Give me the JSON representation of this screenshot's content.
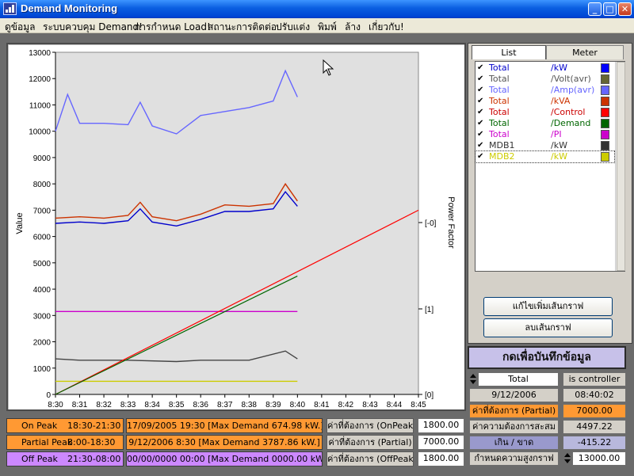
{
  "window": {
    "title": "Demand Monitoring"
  },
  "menu": [
    "ดูข้อมูล",
    "ระบบควบคุม Demand!",
    "การกำหนด Load!",
    "สถานะการติดต่อ",
    "ปรับแต่ง",
    "พิมพ์",
    "ล้าง",
    "เกี่ยวกับ!"
  ],
  "tabs": {
    "list": "List",
    "meter": "Meter"
  },
  "channels": [
    {
      "name": "Total",
      "unit": "/kW",
      "color": "#0000ff",
      "text_color": "#0000cc",
      "checked": true
    },
    {
      "name": "Total",
      "unit": "/Volt(avr)",
      "color": "#666633",
      "text_color": "#555555",
      "checked": true
    },
    {
      "name": "Total",
      "unit": "/Amp(avr)",
      "color": "#6666ff",
      "text_color": "#6666ff",
      "checked": true
    },
    {
      "name": "Total",
      "unit": "/kVA",
      "color": "#cc3300",
      "text_color": "#cc3300",
      "checked": true
    },
    {
      "name": "Total",
      "unit": "/Control",
      "color": "#ff0000",
      "text_color": "#cc0000",
      "checked": true
    },
    {
      "name": "Total",
      "unit": "/Demand",
      "color": "#006600",
      "text_color": "#006600",
      "checked": true
    },
    {
      "name": "Total",
      "unit": "/PI",
      "color": "#cc00cc",
      "text_color": "#cc00cc",
      "checked": true
    },
    {
      "name": "MDB1",
      "unit": "/kW",
      "color": "#333333",
      "text_color": "#333333",
      "checked": true
    },
    {
      "name": "MDB2",
      "unit": "/kW",
      "color": "#cccc00",
      "text_color": "#cccc00",
      "checked": true
    }
  ],
  "buttons": {
    "edit_line": "แก้ไขเพิ่มเส้นกราฟ",
    "delete_line": "ลบเส้นกราฟ",
    "save": "กดเพื่อบันทึกข้อมูล"
  },
  "readouts": {
    "selector": "Total",
    "status": "is controller",
    "date": "9/12/2006",
    "time": "08:40:02",
    "partial_label": "ค่าที่ต้องการ (Partial)",
    "partial_value": "7000.00",
    "accum_label": "ค่าความต้องการสะสม",
    "accum_value": "4497.22",
    "over_label": "เกิน / ขาด",
    "over_value": "-415.22",
    "graph_max_label": "กำหนดความสูงกราฟ",
    "graph_max_value": "13000.00"
  },
  "peaks": [
    {
      "name": "On Peak",
      "hours": "18:30-21:30",
      "max": "17/09/2005  19:30 [Max Demand   674.98 kW.]",
      "need_label": "ค่าที่ต้องการ (OnPeak)",
      "need_value": "1800.00"
    },
    {
      "name": "Partial Peak",
      "hours": "8:00-18:30",
      "max": "9/12/2006   8:30 [Max Demand  3787.86 kW.]",
      "need_label": "ค่าที่ต้องการ (Partial)",
      "need_value": "7000.00"
    },
    {
      "name": "Off Peak",
      "hours": "21:30-08:00",
      "max": "00/00/0000  00:00 [Max Demand 0000.00 kW.]",
      "need_label": "ค่าที่ต้องการ (OffPeak)",
      "need_value": "1800.00"
    }
  ],
  "chart_data": {
    "type": "line",
    "ylabel": "Value",
    "y2label": "Power Factor",
    "ylim": [
      0,
      13000
    ],
    "yticks": [
      0,
      1000,
      2000,
      3000,
      4000,
      5000,
      6000,
      7000,
      8000,
      9000,
      10000,
      11000,
      12000,
      13000
    ],
    "y2ticks": [
      "[0]",
      "[1]",
      "[-0]"
    ],
    "xticks": [
      "8:30",
      "8:31",
      "8:32",
      "8:33",
      "8:34",
      "8:35",
      "8:36",
      "8:37",
      "8:38",
      "8:39",
      "8:40",
      "8:41",
      "8:42",
      "8:43",
      "8:44",
      "8:45"
    ],
    "grid": false,
    "series": [
      {
        "color": "#0000cc",
        "x": [
          "8:30",
          "8:31",
          "8:32",
          "8:33",
          "8:33:30",
          "8:34",
          "8:35",
          "8:36",
          "8:37",
          "8:38",
          "8:39",
          "8:39:30",
          "8:40"
        ],
        "values": [
          6500,
          6550,
          6500,
          6600,
          7050,
          6550,
          6400,
          6650,
          6950,
          6950,
          7050,
          7700,
          7150
        ]
      },
      {
        "color": "#cc3300",
        "x": [
          "8:30",
          "8:31",
          "8:32",
          "8:33",
          "8:33:30",
          "8:34",
          "8:35",
          "8:36",
          "8:37",
          "8:38",
          "8:39",
          "8:39:30",
          "8:40"
        ],
        "values": [
          6700,
          6750,
          6700,
          6800,
          7300,
          6750,
          6600,
          6850,
          7200,
          7150,
          7250,
          8000,
          7350
        ]
      },
      {
        "color": "#6666ff",
        "x": [
          "8:30",
          "8:30:30",
          "8:31",
          "8:32",
          "8:33",
          "8:33:30",
          "8:34",
          "8:35",
          "8:36",
          "8:37",
          "8:38",
          "8:39",
          "8:39:30",
          "8:40"
        ],
        "values": [
          10000,
          11400,
          10300,
          10300,
          10250,
          11100,
          10200,
          9900,
          10600,
          10750,
          10900,
          11150,
          12300,
          11300
        ]
      },
      {
        "color": "#cc00cc",
        "x": [
          "8:30",
          "8:33:30",
          "8:35",
          "8:40"
        ],
        "values": [
          3150,
          3150,
          3150,
          3150
        ]
      },
      {
        "color": "#444444",
        "x": [
          "8:30",
          "8:31",
          "8:33",
          "8:35",
          "8:36",
          "8:38",
          "8:39:30",
          "8:40"
        ],
        "values": [
          1350,
          1300,
          1300,
          1250,
          1300,
          1300,
          1650,
          1350
        ]
      },
      {
        "color": "#cccc00",
        "x": [
          "8:30",
          "8:40"
        ],
        "values": [
          500,
          500
        ]
      },
      {
        "color": "#ff0000",
        "x": [
          "8:30",
          "8:45"
        ],
        "values": [
          0,
          7000
        ]
      },
      {
        "color": "#006600",
        "x": [
          "8:30",
          "8:40"
        ],
        "values": [
          0,
          4497
        ]
      }
    ]
  }
}
